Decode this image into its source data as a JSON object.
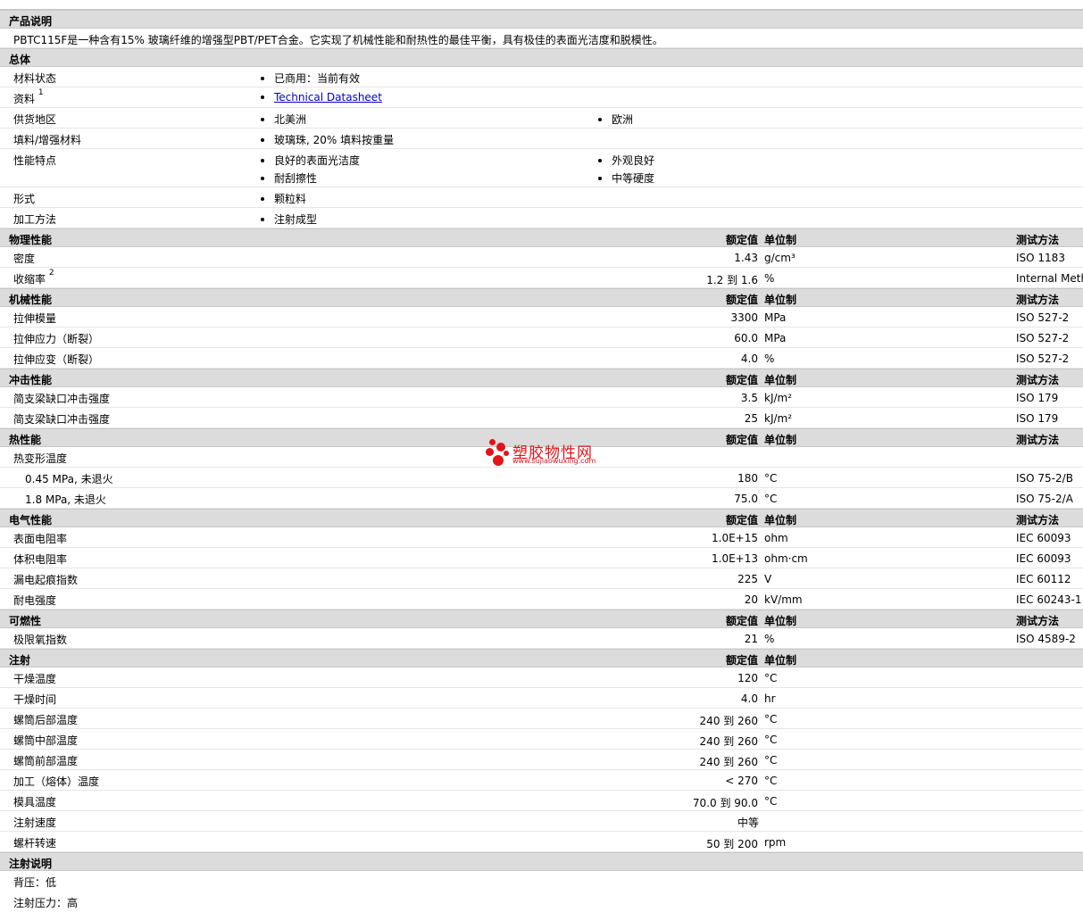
{
  "sections": {
    "product_desc": "产品说明",
    "general": "总体",
    "physical": "物理性能",
    "mechanical": "机械性能",
    "impact": "冲击性能",
    "thermal": "热性能",
    "electrical": "电气性能",
    "flammability": "可燃性",
    "injection": "注射",
    "injection_notes": "注射说明"
  },
  "headers": {
    "value": "额定值",
    "unit": "单位制",
    "method": "测试方法"
  },
  "description": "PBTC115F是一种含有15% 玻璃纤维的增强型PBT/PET合金。它实现了机械性能和耐热性的最佳平衡，具有极佳的表面光洁度和脱模性。",
  "general": {
    "status_label": "材料状态",
    "status": "已商用：当前有效",
    "doc_label": "资料",
    "doc_sup": "1",
    "doc_link": "Technical Datasheet",
    "region_label": "供货地区",
    "region_1": "北美洲",
    "region_2": "欧洲",
    "filler_label": "填料/增强材料",
    "filler": "玻璃珠, 20% 填料按重量",
    "features_label": "性能特点",
    "feature_1": "良好的表面光洁度",
    "feature_2": "外观良好",
    "feature_3": "耐刮擦性",
    "feature_4": "中等硬度",
    "form_label": "形式",
    "form": "颗粒料",
    "process_label": "加工方法",
    "process": "注射成型"
  },
  "physical": [
    {
      "label": "密度",
      "value": "1.43",
      "unit": "g/cm³",
      "method": "ISO 1183"
    },
    {
      "label": "收缩率",
      "sup": "2",
      "value": "1.2 到  1.6",
      "unit": "%",
      "method": "Internal Metho"
    }
  ],
  "mechanical": [
    {
      "label": "拉伸模量",
      "value": "3300",
      "unit": "MPa",
      "method": "ISO 527-2"
    },
    {
      "label": "拉伸应力（断裂）",
      "value": "60.0",
      "unit": "MPa",
      "method": "ISO 527-2"
    },
    {
      "label": "拉伸应变（断裂）",
      "value": "4.0",
      "unit": "%",
      "method": "ISO 527-2"
    }
  ],
  "impact": [
    {
      "label": "简支梁缺口冲击强度",
      "value": "3.5",
      "unit": "kJ/m²",
      "method": "ISO 179"
    },
    {
      "label": "简支梁缺口冲击强度",
      "value": "25",
      "unit": "kJ/m²",
      "method": "ISO 179"
    }
  ],
  "thermal": {
    "hdt_label": "热变形温度",
    "rows": [
      {
        "label": "0.45 MPa, 未退火",
        "value": "180",
        "unit": "°C",
        "method": "ISO 75-2/B"
      },
      {
        "label": "1.8 MPa, 未退火",
        "value": "75.0",
        "unit": "°C",
        "method": "ISO 75-2/A"
      }
    ]
  },
  "electrical": [
    {
      "label": "表面电阻率",
      "value": "1.0E+15",
      "unit": "ohm",
      "method": "IEC 60093"
    },
    {
      "label": "体积电阻率",
      "value": "1.0E+13",
      "unit": "ohm·cm",
      "method": "IEC 60093"
    },
    {
      "label": "漏电起痕指数",
      "value": "225",
      "unit": "V",
      "method": "IEC 60112"
    },
    {
      "label": "耐电强度",
      "value": "20",
      "unit": "kV/mm",
      "method": "IEC 60243-1"
    }
  ],
  "flammability": [
    {
      "label": "极限氧指数",
      "value": "21",
      "unit": "%",
      "method": "ISO 4589-2"
    }
  ],
  "injection": [
    {
      "label": "干燥温度",
      "value": "120",
      "unit": "°C"
    },
    {
      "label": "干燥时间",
      "value": "4.0",
      "unit": "hr"
    },
    {
      "label": "螺筒后部温度",
      "value": "240 到  260",
      "unit": "°C"
    },
    {
      "label": "螺筒中部温度",
      "value": "240 到  260",
      "unit": "°C"
    },
    {
      "label": "螺筒前部温度",
      "value": "240 到  260",
      "unit": "°C"
    },
    {
      "label": "加工（熔体）温度",
      "value": "< 270",
      "unit": "°C"
    },
    {
      "label": "模具温度",
      "value": "70.0 到  90.0",
      "unit": "°C"
    },
    {
      "label": "注射速度",
      "mid": "中等"
    },
    {
      "label": "螺杆转速",
      "value": "50 到  200",
      "unit": "rpm"
    }
  ],
  "injection_notes": [
    "背压：低",
    "注射压力：高"
  ],
  "watermark": {
    "title": "塑胶物性网",
    "url": "www.sujiaowuxing.com",
    "color": "#e0141a"
  }
}
